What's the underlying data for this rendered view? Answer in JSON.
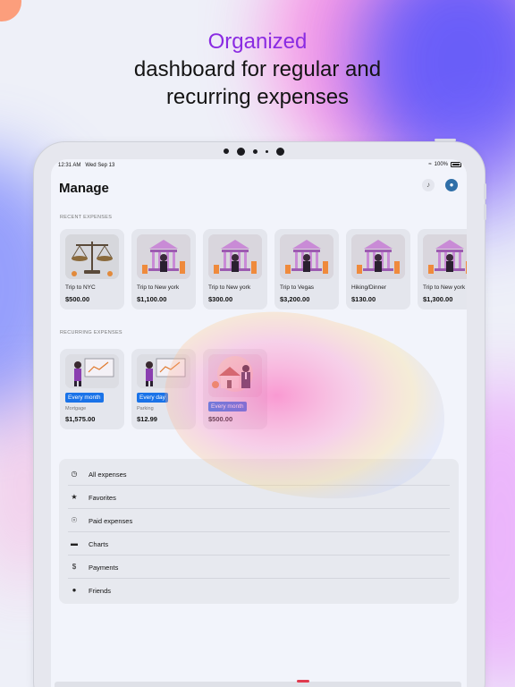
{
  "headline": {
    "accent": "Organized",
    "line1": "dashboard for regular and",
    "line2": "recurring expenses"
  },
  "statusbar": {
    "time": "12:31 AM",
    "date": "Wed Sep 13",
    "battery": "100%"
  },
  "header": {
    "title": "Manage",
    "bell_icon": "bell-icon",
    "profile_icon": "globe-avatar-icon"
  },
  "recent": {
    "label": "RECENT EXPENSES",
    "items": [
      {
        "name": "Trip to NYC",
        "amount": "$500.00",
        "icon": "scales-icon"
      },
      {
        "name": "Trip to New york",
        "amount": "$1,100.00",
        "icon": "bank-icon"
      },
      {
        "name": "Trip to New york",
        "amount": "$300.00",
        "icon": "bank-icon"
      },
      {
        "name": "Trip to Vegas",
        "amount": "$3,200.00",
        "icon": "bank-icon"
      },
      {
        "name": "Hiking/Dinner",
        "amount": "$130.00",
        "icon": "bank-icon"
      },
      {
        "name": "Trip to New york",
        "amount": "$1,300.00",
        "icon": "bank-icon"
      }
    ]
  },
  "recurring": {
    "label": "RECURRING EXPENSES",
    "items": [
      {
        "frequency": "Every month",
        "category": "Mortgage",
        "amount": "$1,575.00",
        "icon": "presentation-icon"
      },
      {
        "frequency": "Every day",
        "category": "Parking",
        "amount": "$12.99",
        "icon": "presentation-icon"
      },
      {
        "frequency": "Every month",
        "category": "",
        "amount": "$500.00",
        "icon": "house-agent-icon"
      }
    ]
  },
  "menu": {
    "items": [
      {
        "label": "All expenses",
        "icon": "clock-icon"
      },
      {
        "label": "Favorites",
        "icon": "star-icon"
      },
      {
        "label": "Paid expenses",
        "icon": "dollar-circle-icon"
      },
      {
        "label": "Charts",
        "icon": "bar-chart-icon"
      },
      {
        "label": "Payments",
        "icon": "dollar-icon"
      },
      {
        "label": "Friends",
        "icon": "person-icon"
      }
    ]
  },
  "colors": {
    "accent": "#8a2be2",
    "badge": "#1a73e8"
  }
}
